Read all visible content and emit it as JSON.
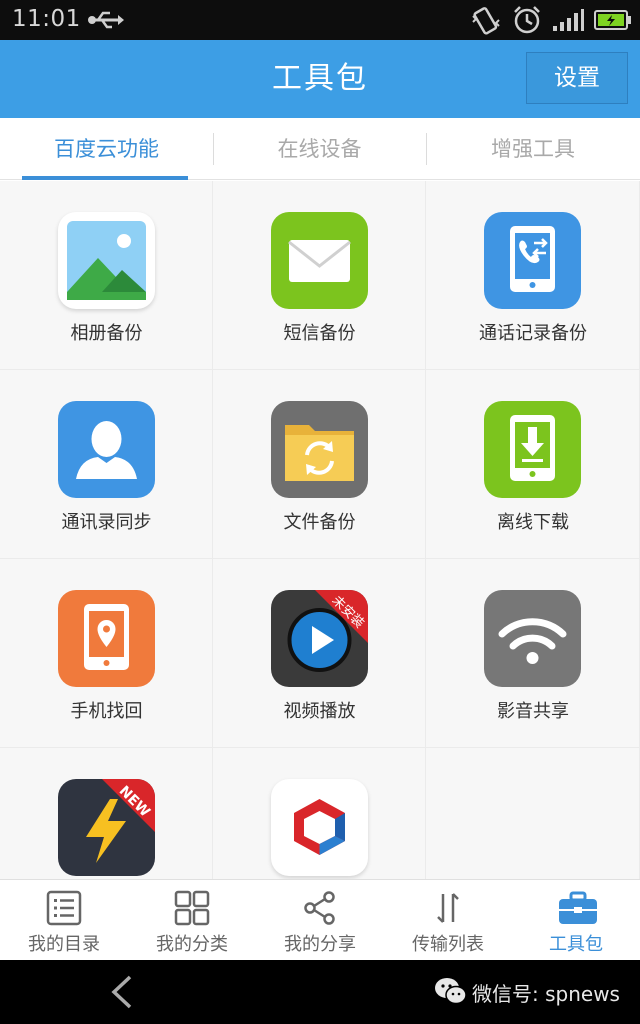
{
  "status_bar": {
    "time": "11:01"
  },
  "header": {
    "title": "工具包",
    "settings_label": "设置"
  },
  "tabs": [
    {
      "label": "百度云功能",
      "active": true
    },
    {
      "label": "在线设备",
      "active": false
    },
    {
      "label": "增强工具",
      "active": false
    }
  ],
  "tools": [
    {
      "label": "相册备份",
      "icon": "photo-album-icon"
    },
    {
      "label": "短信备份",
      "icon": "sms-envelope-icon"
    },
    {
      "label": "通话记录备份",
      "icon": "call-log-icon"
    },
    {
      "label": "通讯录同步",
      "icon": "contact-person-icon"
    },
    {
      "label": "文件备份",
      "icon": "folder-sync-icon"
    },
    {
      "label": "离线下载",
      "icon": "offline-download-icon"
    },
    {
      "label": "手机找回",
      "icon": "phone-locate-icon"
    },
    {
      "label": "视频播放",
      "icon": "video-play-icon",
      "ribbon": "未安装"
    },
    {
      "label": "影音共享",
      "icon": "wifi-share-icon"
    },
    {
      "label": "",
      "icon": "lightning-icon",
      "ribbon": "NEW"
    },
    {
      "label": "",
      "icon": "cube-logo-icon"
    }
  ],
  "bottom_nav": [
    {
      "label": "我的目录",
      "icon": "list-icon"
    },
    {
      "label": "我的分类",
      "icon": "grid-icon"
    },
    {
      "label": "我的分享",
      "icon": "share-icon"
    },
    {
      "label": "传输列表",
      "icon": "transfer-icon"
    },
    {
      "label": "工具包",
      "icon": "toolbox-icon",
      "active": true
    }
  ],
  "watermark": {
    "text": "微信号: spnews"
  },
  "colors": {
    "accent": "#3d9ee5",
    "tab_active": "#3b8fd8"
  }
}
